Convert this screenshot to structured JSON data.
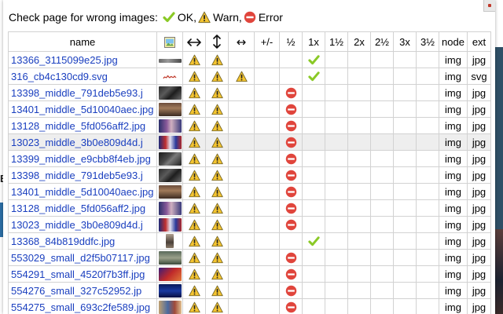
{
  "legend": {
    "prefix": "Check page for wrong images:",
    "ok": "OK,",
    "warn": "Warn,",
    "error": "Error"
  },
  "colors": {
    "ok": "#8ac926",
    "warn": "#f4c430",
    "error": "#e0453c",
    "link": "#1a3fbf"
  },
  "headers": [
    "name",
    "",
    "",
    "",
    "",
    "+/-",
    "½",
    "1x",
    "1½",
    "2x",
    "2½",
    "3x",
    "3½",
    "node",
    "ext"
  ],
  "header_icons": {
    "thumb": "image-thumbnail-icon",
    "width": "horizontal-arrows-icon",
    "height": "vertical-arrows-icon",
    "small_width": "small-horizontal-arrows-icon"
  },
  "rows": [
    {
      "name": "13366_3115099e25.jpg",
      "thumb": "strip",
      "w": "warn",
      "h": "warn",
      "sw": "",
      "ratio": "",
      "half": "",
      "x1": "ok",
      "node": "img",
      "ext": "jpg"
    },
    {
      "name": "316_cb4c130cd9.svg",
      "thumb": "signature",
      "w": "warn",
      "h": "warn",
      "sw": "warn",
      "ratio": "",
      "half": "",
      "x1": "ok",
      "node": "img",
      "ext": "svg"
    },
    {
      "name": "13398_middle_791deb5e93.j",
      "thumb": "dark",
      "w": "warn",
      "h": "warn",
      "sw": "",
      "ratio": "",
      "half": "error",
      "x1": "",
      "node": "img",
      "ext": "jpg"
    },
    {
      "name": "13401_middle_5d10040aec.jpg",
      "thumb": "chamber",
      "w": "warn",
      "h": "warn",
      "sw": "",
      "ratio": "",
      "half": "error",
      "x1": "",
      "node": "img",
      "ext": "jpg"
    },
    {
      "name": "13128_middle_5fd056aff2.jpg",
      "thumb": "crowd",
      "w": "warn",
      "h": "warn",
      "sw": "",
      "ratio": "",
      "half": "error",
      "x1": "",
      "node": "img",
      "ext": "jpg"
    },
    {
      "name": "13023_middle_3b0e809d4d.j",
      "thumb": "flags",
      "w": "warn",
      "h": "warn",
      "sw": "",
      "ratio": "",
      "half": "error",
      "x1": "",
      "node": "img",
      "ext": "jpg"
    },
    {
      "name": "13399_middle_e9cbb8f4eb.jpg",
      "thumb": "dark2",
      "w": "warn",
      "h": "warn",
      "sw": "",
      "ratio": "",
      "half": "error",
      "x1": "",
      "node": "img",
      "ext": "jpg"
    },
    {
      "name": "13398_middle_791deb5e93.j",
      "thumb": "dark",
      "w": "warn",
      "h": "warn",
      "sw": "",
      "ratio": "",
      "half": "error",
      "x1": "",
      "node": "img",
      "ext": "jpg"
    },
    {
      "name": "13401_middle_5d10040aec.jpg",
      "thumb": "chamber",
      "w": "warn",
      "h": "warn",
      "sw": "",
      "ratio": "",
      "half": "error",
      "x1": "",
      "node": "img",
      "ext": "jpg"
    },
    {
      "name": "13128_middle_5fd056aff2.jpg",
      "thumb": "crowd",
      "w": "warn",
      "h": "warn",
      "sw": "",
      "ratio": "",
      "half": "error",
      "x1": "",
      "node": "img",
      "ext": "jpg"
    },
    {
      "name": "13023_middle_3b0e809d4d.j",
      "thumb": "flags",
      "w": "warn",
      "h": "warn",
      "sw": "",
      "ratio": "",
      "half": "error",
      "x1": "",
      "node": "img",
      "ext": "jpg"
    },
    {
      "name": "13368_84b819ddfc.jpg",
      "thumb": "portrait",
      "w": "warn",
      "h": "warn",
      "sw": "",
      "ratio": "",
      "half": "",
      "x1": "ok",
      "node": "img",
      "ext": "jpg"
    },
    {
      "name": "553029_small_d2f5b07117.jpg",
      "thumb": "room",
      "w": "warn",
      "h": "warn",
      "sw": "",
      "ratio": "",
      "half": "error",
      "x1": "",
      "node": "img",
      "ext": "jpg"
    },
    {
      "name": "554291_small_4520f7b3ff.jpg",
      "thumb": "red",
      "w": "warn",
      "h": "warn",
      "sw": "",
      "ratio": "",
      "half": "error",
      "x1": "",
      "node": "img",
      "ext": "jpg"
    },
    {
      "name": "554276_small_327c52952.jp",
      "thumb": "blue",
      "w": "warn",
      "h": "warn",
      "sw": "",
      "ratio": "",
      "half": "error",
      "x1": "",
      "node": "img",
      "ext": "jpg"
    },
    {
      "name": "554275_small_693c2fe589.jpg",
      "thumb": "mixed",
      "w": "warn",
      "h": "warn",
      "sw": "",
      "ratio": "",
      "half": "error",
      "x1": "",
      "node": "img",
      "ext": "jpg"
    }
  ],
  "highlighted_row": 5
}
